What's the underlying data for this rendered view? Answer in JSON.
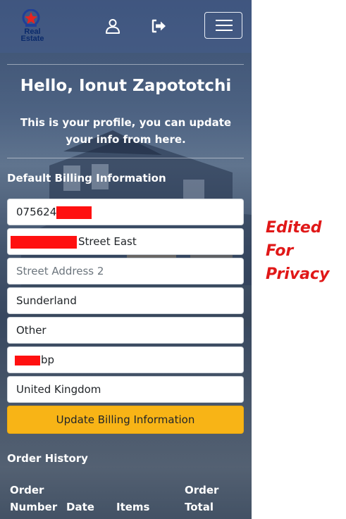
{
  "brand": {
    "logo_line1": "Real",
    "logo_line2": "Estate"
  },
  "nav": {
    "icons": [
      "user-icon",
      "logout-icon",
      "hamburger-menu-icon"
    ]
  },
  "profile": {
    "greeting": "Hello, Ionut Zapototchi",
    "subtitle": "This is your profile, you can update your info from here."
  },
  "billing": {
    "title": "Default Billing Information",
    "phone_visible": "075624",
    "street1_visible": "Street East",
    "street2_placeholder": "Street Address 2",
    "city": "Sunderland",
    "county": "Other",
    "postcode_visible": "bp",
    "country": "United Kingdom",
    "update_label": "Update Billing Information"
  },
  "orders": {
    "title": "Order History",
    "col_order_number_1": "Order",
    "col_order_number_2": "Number",
    "col_date": "Date",
    "col_items": "Items",
    "col_total_1": "Order",
    "col_total_2": "Total"
  },
  "annotation": {
    "line1": "Edited",
    "line2": "For",
    "line3": "Privacy"
  },
  "colors": {
    "accent_button": "#f8b416",
    "redaction": "#ff1010",
    "annotation": "#e01818"
  }
}
